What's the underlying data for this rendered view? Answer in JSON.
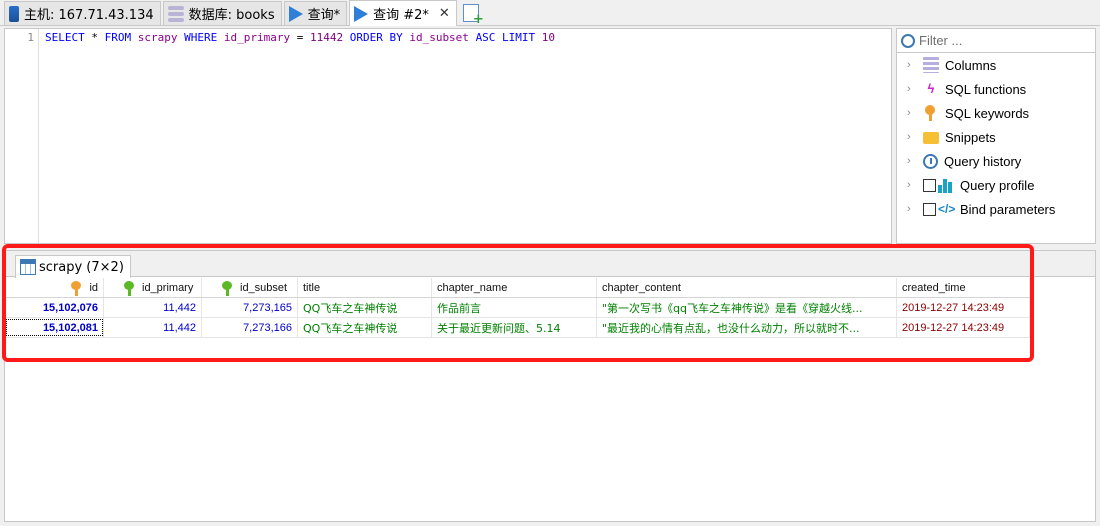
{
  "tabs": [
    {
      "label": "主机: 167.71.43.134",
      "icon": "server-icon"
    },
    {
      "label": "数据库: books",
      "icon": "database-icon"
    },
    {
      "label": "查询*",
      "icon": "query-play-icon"
    },
    {
      "label": "查询 #2*",
      "icon": "query-play-icon",
      "active": true
    }
  ],
  "editor": {
    "line_number": "1",
    "sql_tokens": {
      "select": "SELECT",
      "star": " * ",
      "from": "FROM",
      "table": " scrapy ",
      "where": "WHERE",
      "col": " id_primary ",
      "eq": "= ",
      "value": "11442",
      "order": " ORDER BY",
      "ordercol": " id_subset ",
      "asc": "ASC",
      "limit": " LIMIT ",
      "limitval": "10"
    }
  },
  "helper": {
    "filter_placeholder": "Filter ...",
    "items": [
      {
        "label": "Columns",
        "icon": "columns-icon"
      },
      {
        "label": "SQL functions",
        "icon": "lightning-icon"
      },
      {
        "label": "SQL keywords",
        "icon": "key-icon"
      },
      {
        "label": "Snippets",
        "icon": "folder-icon"
      },
      {
        "label": "Query history",
        "icon": "clock-icon"
      },
      {
        "label": "Query profile",
        "icon": "bar-chart-icon"
      },
      {
        "label": "Bind parameters",
        "icon": "code-icon"
      }
    ]
  },
  "results": {
    "tab_label": "scrapy (7×2)",
    "columns": [
      "id",
      "id_primary",
      "id_subset",
      "title",
      "chapter_name",
      "chapter_content",
      "created_time"
    ],
    "rows": [
      [
        "15,102,076",
        "11,442",
        "7,273,165",
        "QQ飞车之车神传说",
        "作品前言",
        "\"第一次写书《qq飞车之车神传说》是看《穿越火线...",
        "2019-12-27 14:23:49"
      ],
      [
        "15,102,081",
        "11,442",
        "7,273,166",
        "QQ飞车之车神传说",
        "关于最近更新问题、5.14",
        "\"最近我的心情有点乱，也没什么动力，所以就时不...",
        "2019-12-27 14:23:49"
      ]
    ]
  },
  "colors": {
    "highlight": "#ff1a1a",
    "keyword": "#0000ff",
    "identifier": "#8b008b",
    "number": "#0000c8",
    "string": "#008000",
    "datetime": "#8b0000"
  }
}
